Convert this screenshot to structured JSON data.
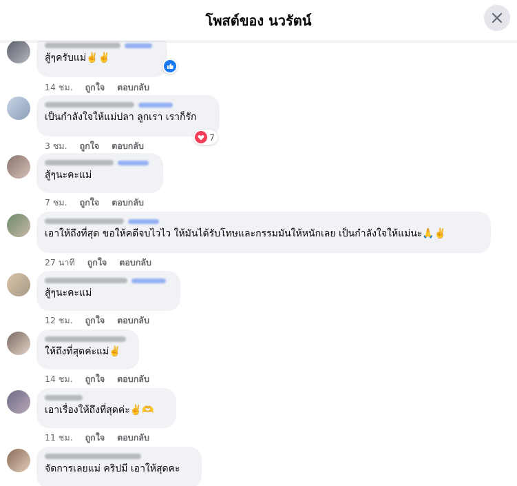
{
  "header": {
    "title": "โพสต์ของ นวรัตน์"
  },
  "colors": {
    "bubble": "#f0f2f5",
    "meta": "#65676b",
    "like_blue": "#1877f2",
    "heart_red": "#f33e58"
  },
  "comments": [
    {
      "text": "สู้ๆครับแม่✌️✌️",
      "time": "14 ชม.",
      "like": "ถูกใจ",
      "reply": "ตอบกลับ",
      "reaction": "like"
    },
    {
      "text": "เป็นกำลังใจให้แม่ปลา ลูกเรา เราก็รัก",
      "time": "3 ชม.",
      "like": "ถูกใจ",
      "reply": "ตอบกลับ",
      "reaction": "love",
      "reaction_count": "7"
    },
    {
      "text": "สู้ๆนะคะแม่",
      "time": "7 ชม.",
      "like": "ถูกใจ",
      "reply": "ตอบกลับ"
    },
    {
      "text": "เอาให้ถึงที่สุด ขอให้คดีจบไวไว ให้มันได้รับโทษและกรรมมันให้หนักเลย เป็นกำลังใจให้แม่นะ🙏✌️",
      "time": "27 นาที",
      "like": "ถูกใจ",
      "reply": "ตอบกลับ"
    },
    {
      "text": "สู้ๆนะคะแม่",
      "time": "12 ชม.",
      "like": "ถูกใจ",
      "reply": "ตอบกลับ"
    },
    {
      "text": "ให้ถึงที่สุดค่ะแม่✌️",
      "time": "14 ชม.",
      "like": "ถูกใจ",
      "reply": "ตอบกลับ"
    },
    {
      "text": "เอาเรื่องให้ถึงที่สุดค่ะ✌️🫶",
      "time": "11 ชม.",
      "like": "ถูกใจ",
      "reply": "ตอบกลับ"
    },
    {
      "text": "จัดการเลยแม่ คริปมี เอาให้สุดคะ"
    }
  ]
}
